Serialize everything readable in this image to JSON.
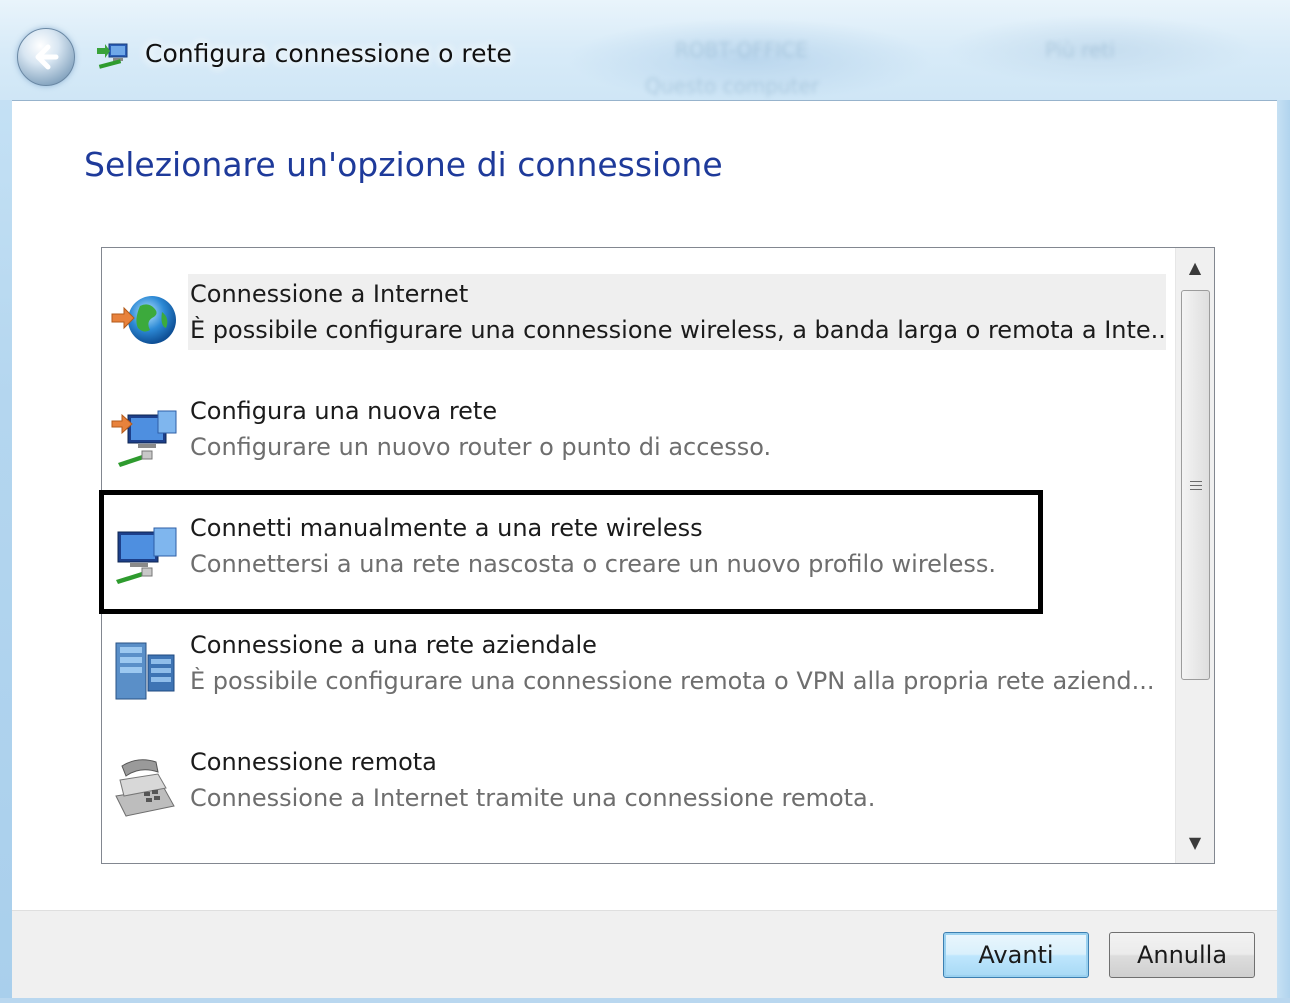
{
  "window": {
    "title": "Configura connessione o rete",
    "background_ghost_texts": [
      "ROBT-OFFICE",
      "Questo computer",
      "Più reti"
    ]
  },
  "heading": "Selezionare un'opzione di connessione",
  "options": [
    {
      "title": "Connessione a Internet",
      "description": "È possibile configurare una connessione wireless, a banda larga o remota a Inte...",
      "icon": "globe-arrow-icon",
      "selected": true
    },
    {
      "title": "Configura una nuova rete",
      "description": "Configurare un nuovo router o punto di accesso.",
      "icon": "network-setup-icon",
      "selected": false
    },
    {
      "title": "Connetti manualmente a una rete wireless",
      "description": "Connettersi a una rete nascosta o creare un nuovo profilo wireless.",
      "icon": "wireless-network-icon",
      "selected": false,
      "highlighted": true
    },
    {
      "title": "Connessione a una rete aziendale",
      "description": "È possibile configurare una connessione remota o VPN alla propria rete aziend...",
      "icon": "workplace-server-icon",
      "selected": false
    },
    {
      "title": "Connessione remota",
      "description": "Connessione a Internet tramite una connessione remota.",
      "icon": "dialup-phone-icon",
      "selected": false
    }
  ],
  "buttons": {
    "next": "Avanti",
    "cancel": "Annulla"
  },
  "colors": {
    "heading": "#1e3a9a",
    "highlight_border": "#000000",
    "selected_row": "#efefef"
  }
}
